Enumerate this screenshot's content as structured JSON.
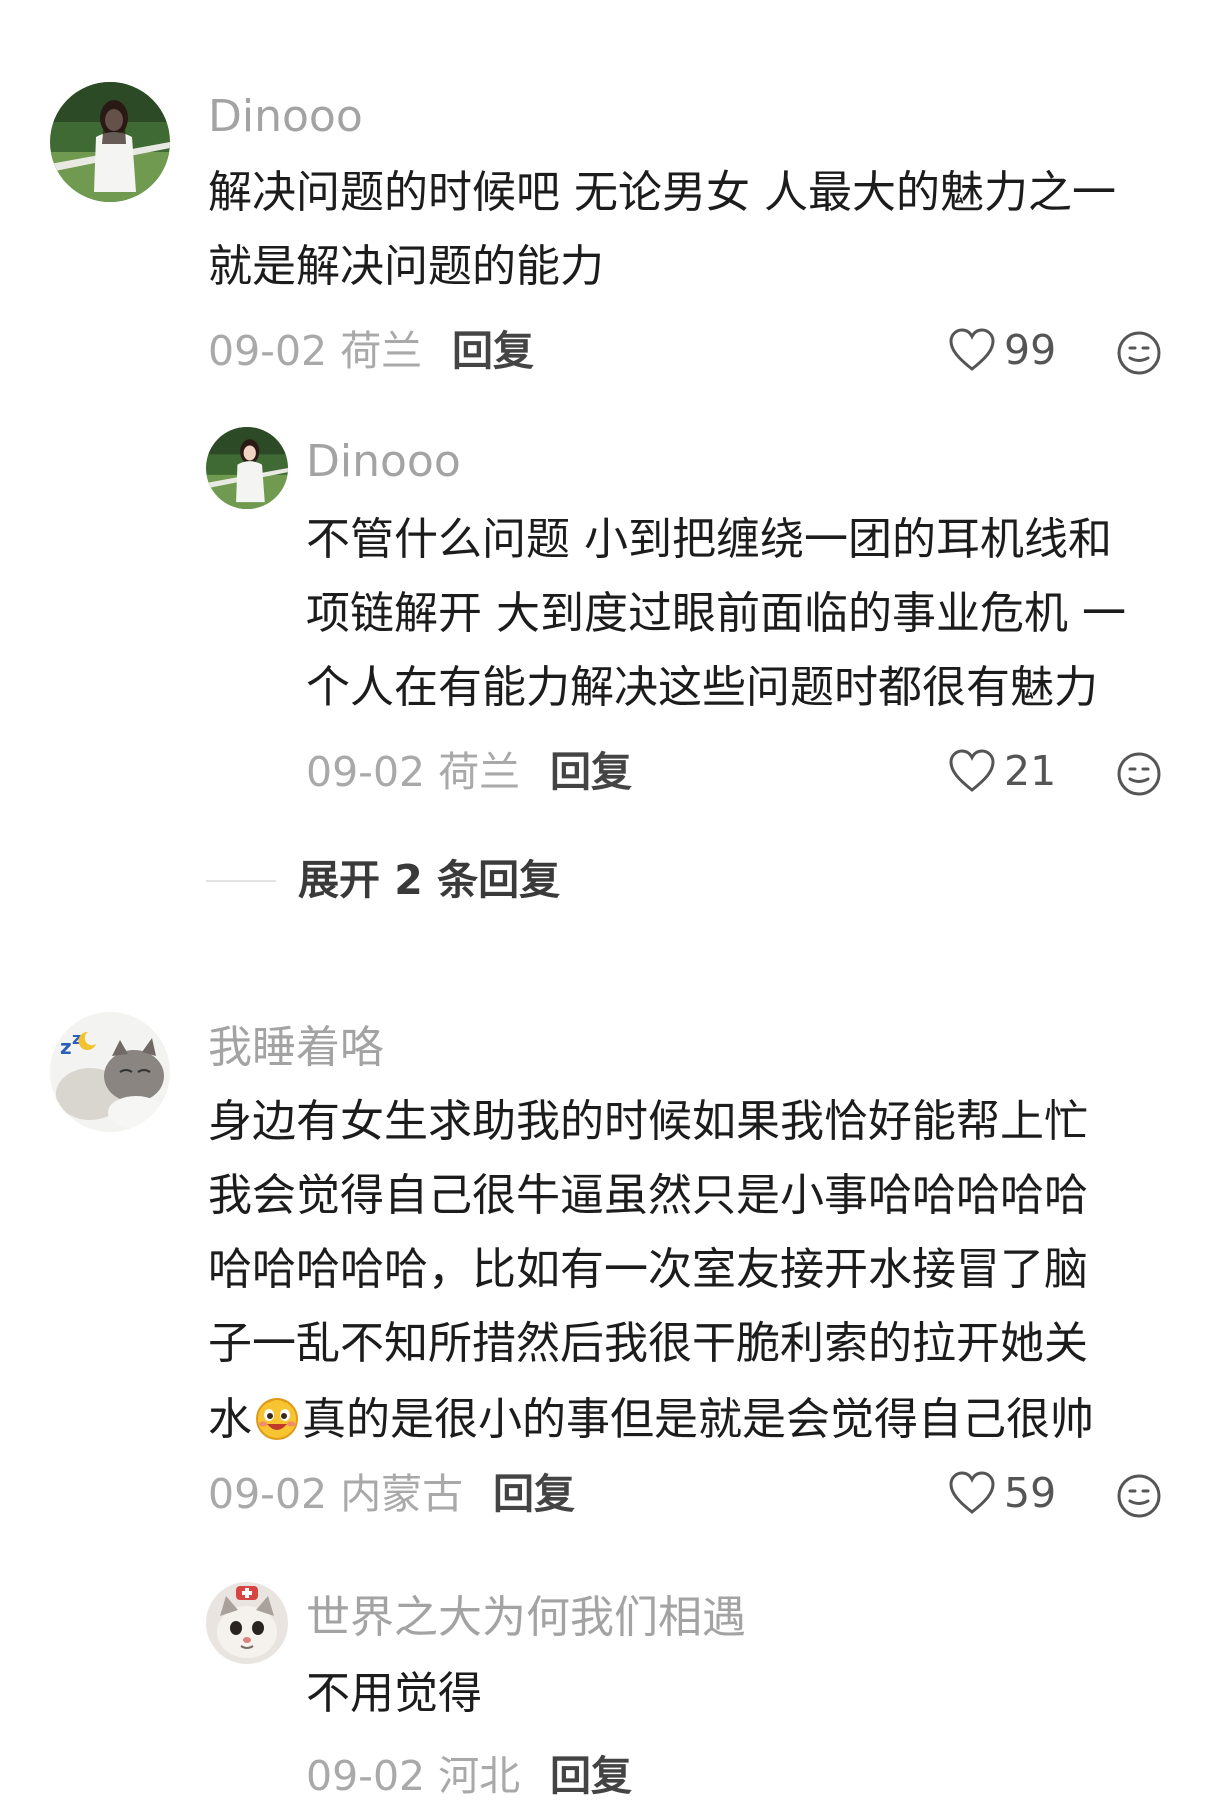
{
  "comments": [
    {
      "user": "Dinooo",
      "lines": [
        "解决问题的时候吧 无论男女 人最大的魅力之一",
        "就是解决问题的能力"
      ],
      "date": "09-02",
      "location": "荷兰",
      "reply_label": "回复",
      "likes": "99",
      "replies": [
        {
          "user": "Dinooo",
          "lines": [
            "不管什么问题 小到把缠绕一团的耳机线和",
            "项链解开 大到度过眼前面临的事业危机 一",
            "个人在有能力解决这些问题时都很有魅力"
          ],
          "date": "09-02",
          "location": "荷兰",
          "reply_label": "回复",
          "likes": "21"
        }
      ],
      "expand_label": "展开 2 条回复"
    },
    {
      "user": "我睡着咯",
      "lines": [
        "身边有女生求助我的时候如果我恰好能帮上忙",
        "我会觉得自己很牛逼虽然只是小事哈哈哈哈哈",
        "哈哈哈哈哈，比如有一次室友接开水接冒了脑",
        "子一乱不知所措然后我很干脆利索的拉开她关"
      ],
      "last_line_start": "水",
      "last_line_end": "真的是很小的事但是就是会觉得自己很帅",
      "date": "09-02",
      "location": "内蒙古",
      "reply_label": "回复",
      "likes": "59",
      "replies": [
        {
          "user": "世界之大为何我们相遇",
          "lines": [
            "不用觉得"
          ],
          "date": "09-02",
          "location": "河北",
          "reply_label": "回复"
        }
      ]
    }
  ],
  "icons": {
    "like": "heart-outline-icon",
    "emoji": "smiley-face-icon",
    "inline": "grinning-face-emoji"
  }
}
